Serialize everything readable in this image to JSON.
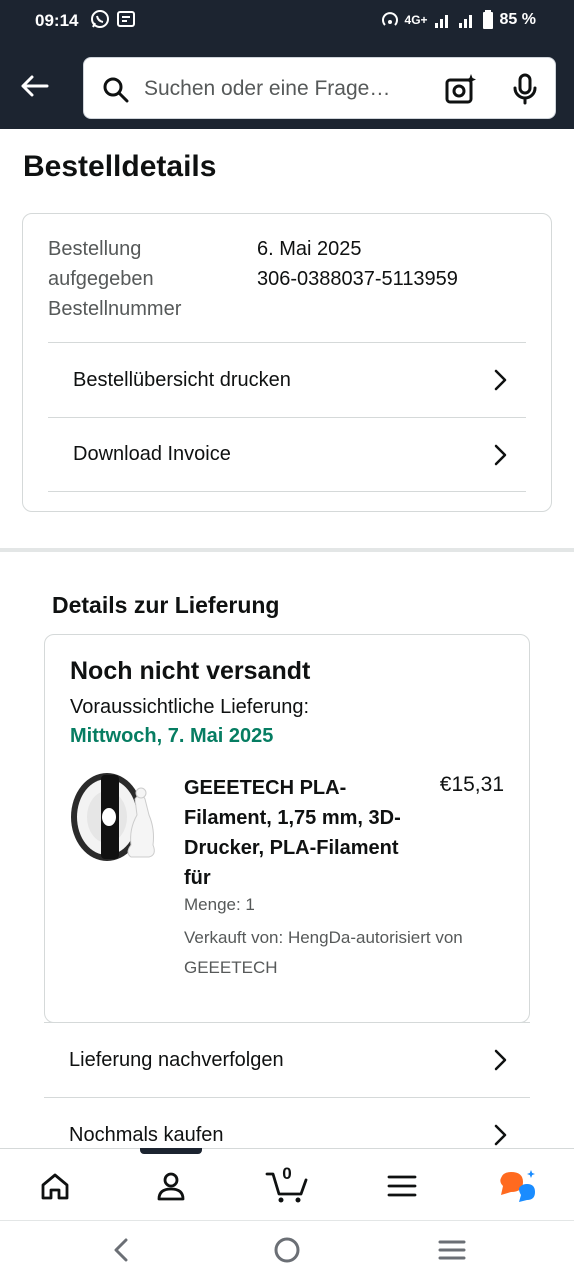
{
  "status_bar": {
    "time": "09:14",
    "network": "4G+",
    "battery": "85 %"
  },
  "header": {
    "search_placeholder": "Suchen oder eine Frage…"
  },
  "page": {
    "title": "Bestelldetails"
  },
  "order_summary": {
    "labels": [
      "Bestellung",
      "aufgegeben",
      "Bestellnummer"
    ],
    "order_date": "6. Mai 2025",
    "order_number": "306-0388037-5113959",
    "actions": [
      {
        "label": "Bestellübersicht drucken"
      },
      {
        "label": "Download Invoice"
      }
    ]
  },
  "delivery": {
    "section_title": "Details zur Lieferung",
    "status": "Noch nicht versandt",
    "estimate_label": "Voraussichtliche Lieferung:",
    "estimate_date": "Mittwoch, 7. Mai 2025",
    "product": {
      "title": "GEEETECH PLA-Filament, 1,75 mm, 3D-Drucker, PLA-Filament für",
      "price": "€15,31",
      "quantity": "Menge: 1",
      "seller": "Verkauft von: HengDa-autorisiert von GEEETECH"
    },
    "actions": [
      {
        "label": "Lieferung nachverfolgen"
      },
      {
        "label": "Nochmals kaufen"
      }
    ]
  },
  "bottom_nav": {
    "cart_count": "0",
    "items": [
      "home-icon",
      "account-icon",
      "cart-icon",
      "menu-icon",
      "rufus-icon"
    ]
  },
  "colors": {
    "header_bg": "#1c2430",
    "delivery_green": "#067d62",
    "rufus_orange": "#ff6a1f",
    "rufus_blue": "#1a8cff"
  }
}
